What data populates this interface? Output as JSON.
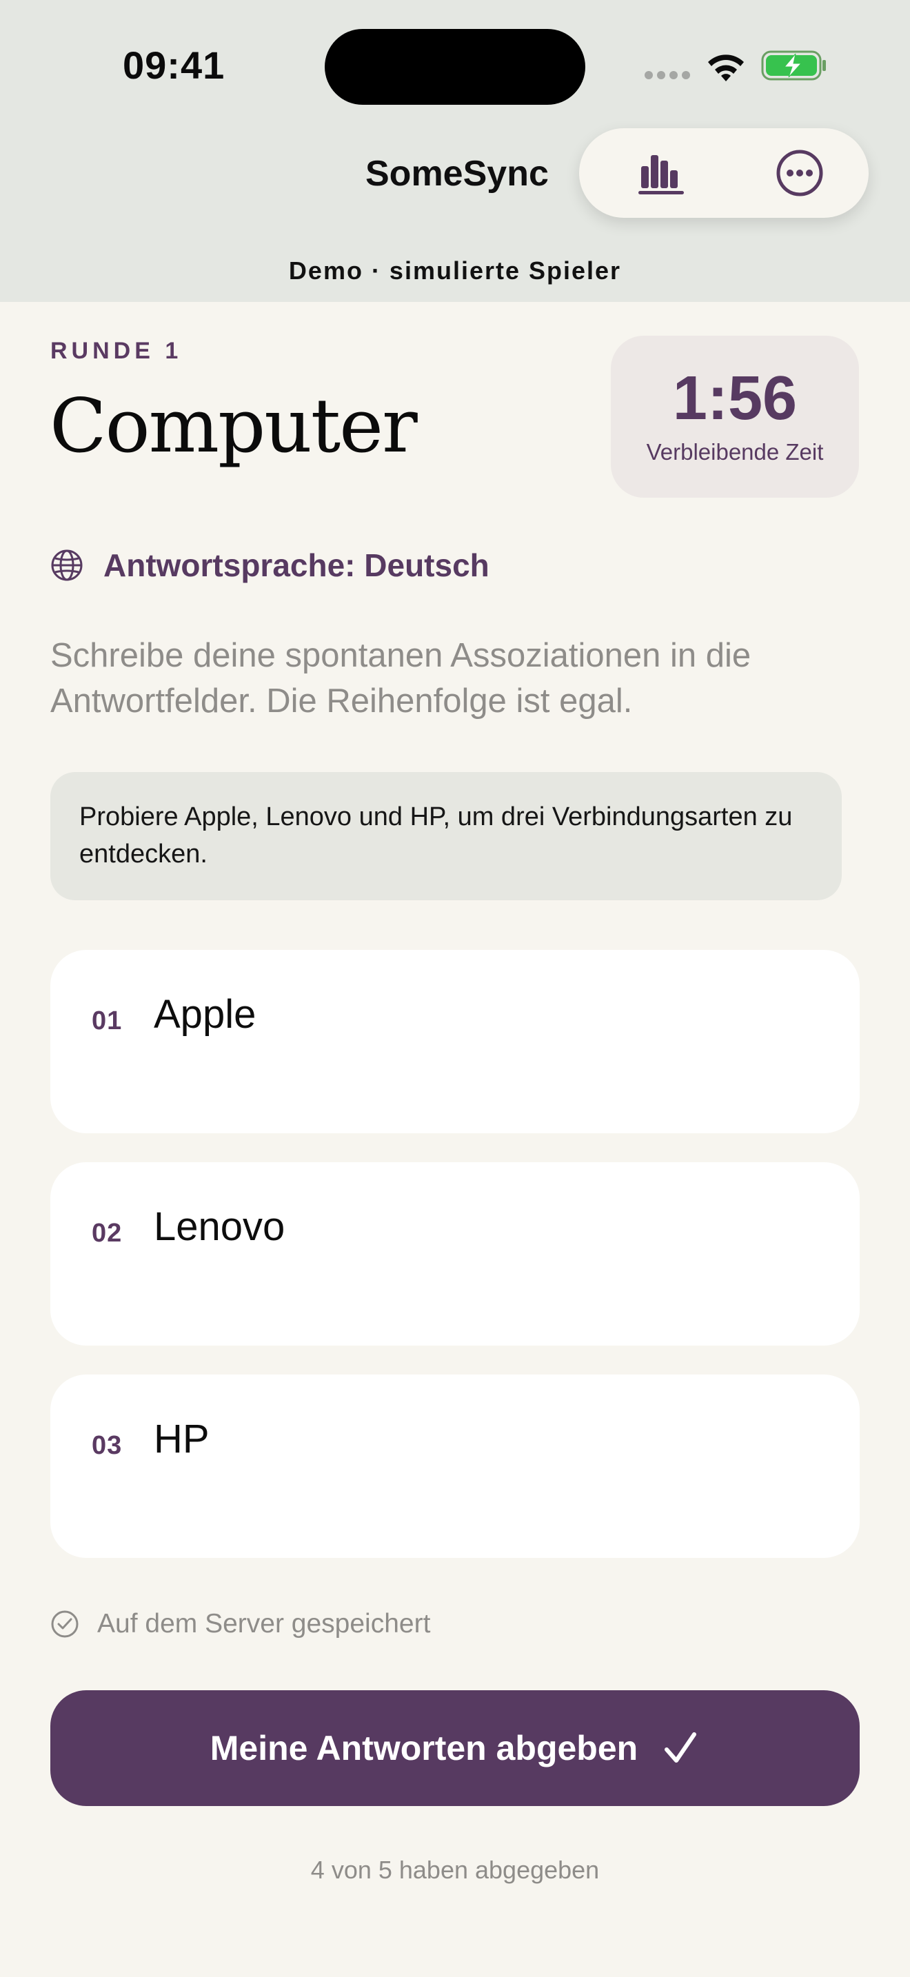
{
  "status_bar": {
    "time": "09:41",
    "icons": [
      "cellular-dots-icon",
      "wifi-icon",
      "battery-charging-icon"
    ]
  },
  "nav": {
    "title": "SomeSync",
    "subtitle": "Demo · simulierte Spieler",
    "actions": [
      "stats-icon",
      "more-icon"
    ]
  },
  "round": {
    "label": "RUNDE 1",
    "title": "Computer",
    "timer_value": "1:56",
    "timer_label": "Verbleibende Zeit"
  },
  "language": {
    "icon": "globe-icon",
    "label": "Antwortsprache: Deutsch"
  },
  "instructions": "Schreibe deine spontanen Assoziationen in die Antwortfelder. Die Reihenfolge ist egal.",
  "hint": "Probiere Apple, Lenovo und HP, um drei Verbindungsarten zu entdecken.",
  "answers": [
    {
      "num": "01",
      "text": "Apple"
    },
    {
      "num": "02",
      "text": "Lenovo"
    },
    {
      "num": "03",
      "text": "HP"
    }
  ],
  "saved_status": "Auf dem Server gespeichert",
  "submit_label": "Meine Antworten abgeben",
  "submission_count": "4 von 5 haben abgegeben",
  "colors": {
    "accent": "#573A61",
    "background": "#F7F5EF",
    "header": "#E4E7E2",
    "muted_text": "#8E8C89"
  }
}
